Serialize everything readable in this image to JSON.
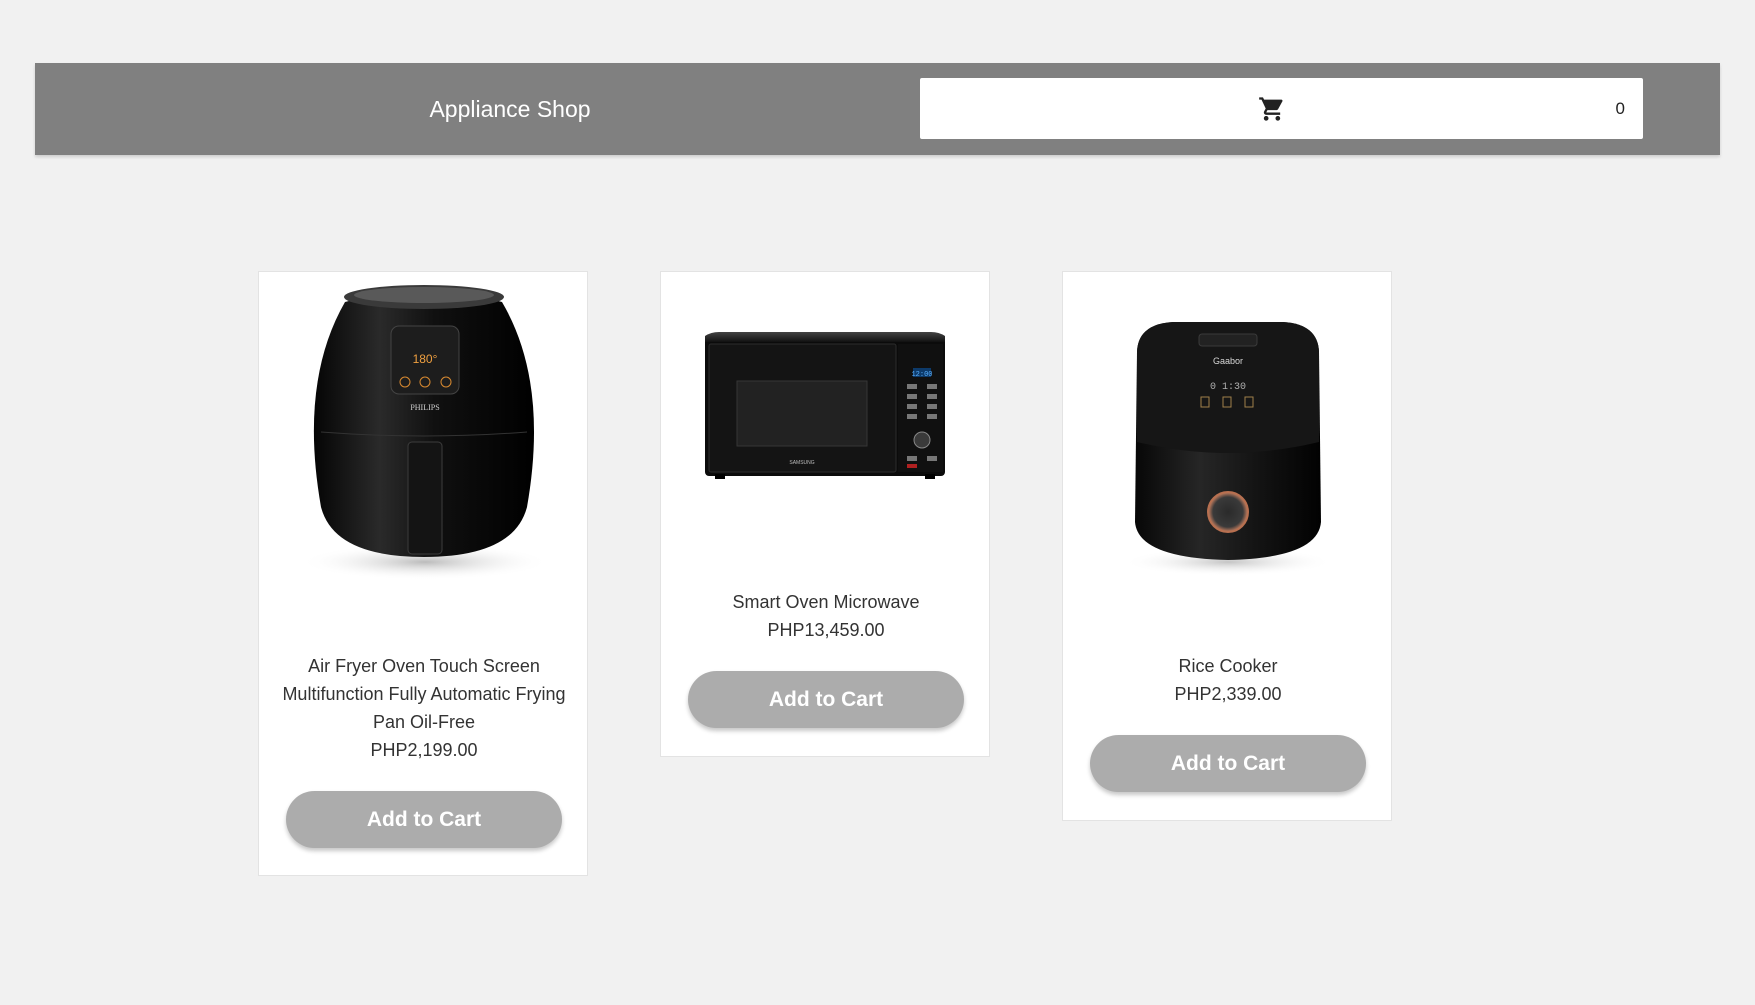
{
  "header": {
    "brand": "Appliance Shop",
    "cart_count": "0",
    "cart_icon": "shopping-cart-icon"
  },
  "products": [
    {
      "name": "Air Fryer Oven Touch Screen Multifunction Fully Automatic Frying Pan Oil-Free",
      "price": "PHP2,199.00",
      "button": "Add to Cart",
      "image_brand": "PHILIPS",
      "image_display": "180°"
    },
    {
      "name": "Smart Oven Microwave",
      "price": "PHP13,459.00",
      "button": "Add to Cart",
      "image_brand": "SAMSUNG",
      "image_display": "12:00"
    },
    {
      "name": "Rice Cooker",
      "price": "PHP2,339.00",
      "button": "Add to Cart",
      "image_brand": "Gaabor",
      "image_display": "0 1:30"
    }
  ],
  "colors": {
    "page_bg": "#f1f1f1",
    "header_bg": "#808080",
    "button_bg": "#acacac"
  }
}
